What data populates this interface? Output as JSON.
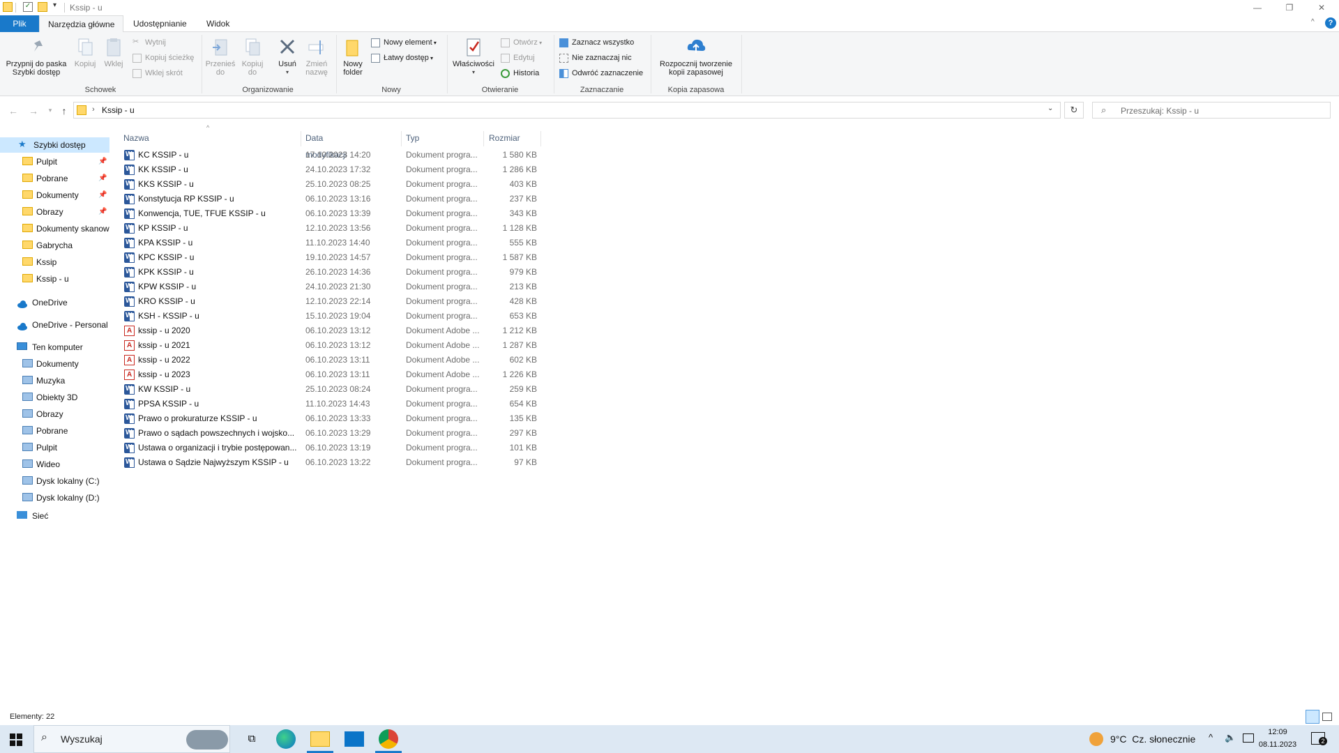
{
  "window": {
    "title": "Kssip - u",
    "minimize": "—",
    "maximize": "❐",
    "close": "✕"
  },
  "tabs": [
    "Plik",
    "Narzędzia główne",
    "Udostępnianie",
    "Widok"
  ],
  "ribbon": {
    "schowek": {
      "label": "Schowek",
      "pin": "Przypnij do paska\nSzybki dostęp",
      "copy": "Kopiuj",
      "paste": "Wklej",
      "cut": "Wytnij",
      "copy_path": "Kopiuj ścieżkę",
      "paste_shortcut": "Wklej skrót"
    },
    "organizuj": {
      "label": "Organizowanie",
      "move": "Przenieś\ndo",
      "copyto": "Kopiuj\ndo",
      "delete": "Usuń",
      "rename": "Zmień\nnazwę"
    },
    "nowy": {
      "label": "Nowy",
      "new_folder": "Nowy\nfolder",
      "new_item": "Nowy element",
      "easy_access": "Łatwy dostęp"
    },
    "otwieranie": {
      "label": "Otwieranie",
      "properties": "Właściwości",
      "open": "Otwórz",
      "edit": "Edytuj",
      "history": "Historia"
    },
    "zaznaczanie": {
      "label": "Zaznaczanie",
      "select_all": "Zaznacz wszystko",
      "select_none": "Nie zaznaczaj nic",
      "invert": "Odwróć zaznaczenie"
    },
    "kopia": {
      "label": "Kopia zapasowa",
      "backup": "Rozpocznij tworzenie\nkopii zapasowej"
    }
  },
  "address": {
    "path": "Kssip - u",
    "search_placeholder": "Przeszukaj: Kssip - u"
  },
  "nav": {
    "quick_access": "Szybki dostęp",
    "quick_items": [
      {
        "label": "Pulpit",
        "pinned": true
      },
      {
        "label": "Pobrane",
        "pinned": true
      },
      {
        "label": "Dokumenty",
        "pinned": true
      },
      {
        "label": "Obrazy",
        "pinned": true
      },
      {
        "label": "Dokumenty skanow",
        "pinned": false
      },
      {
        "label": "Gabrycha",
        "pinned": false
      },
      {
        "label": "Kssip",
        "pinned": false
      },
      {
        "label": "Kssip - u",
        "pinned": false
      }
    ],
    "onedrive": "OneDrive",
    "onedrive_personal": "OneDrive - Personal",
    "this_pc": "Ten komputer",
    "pc_items": [
      "Dokumenty",
      "Muzyka",
      "Obiekty 3D",
      "Obrazy",
      "Pobrane",
      "Pulpit",
      "Wideo",
      "Dysk lokalny (C:)",
      "Dysk lokalny (D:)"
    ],
    "network": "Sieć",
    "pin_glyph": "📌"
  },
  "columns": {
    "name": "Nazwa",
    "date": "Data modyfikacji",
    "type": "Typ",
    "size": "Rozmiar"
  },
  "files": [
    {
      "name": "KC KSSIP - u",
      "date": "17.10.2023 14:20",
      "type": "Dokument progra...",
      "size": "1 580 KB",
      "kind": "word"
    },
    {
      "name": "KK KSSIP - u",
      "date": "24.10.2023 17:32",
      "type": "Dokument progra...",
      "size": "1 286 KB",
      "kind": "word"
    },
    {
      "name": "KKS KSSIP - u",
      "date": "25.10.2023 08:25",
      "type": "Dokument progra...",
      "size": "403 KB",
      "kind": "word"
    },
    {
      "name": "Konstytucja RP KSSIP - u",
      "date": "06.10.2023 13:16",
      "type": "Dokument progra...",
      "size": "237 KB",
      "kind": "word"
    },
    {
      "name": "Konwencja, TUE, TFUE KSSIP - u",
      "date": "06.10.2023 13:39",
      "type": "Dokument progra...",
      "size": "343 KB",
      "kind": "word"
    },
    {
      "name": "KP KSSIP - u",
      "date": "12.10.2023 13:56",
      "type": "Dokument progra...",
      "size": "1 128 KB",
      "kind": "word"
    },
    {
      "name": "KPA KSSIP - u",
      "date": "11.10.2023 14:40",
      "type": "Dokument progra...",
      "size": "555 KB",
      "kind": "word"
    },
    {
      "name": "KPC KSSIP - u",
      "date": "19.10.2023 14:57",
      "type": "Dokument progra...",
      "size": "1 587 KB",
      "kind": "word"
    },
    {
      "name": "KPK KSSIP - u",
      "date": "26.10.2023 14:36",
      "type": "Dokument progra...",
      "size": "979 KB",
      "kind": "word"
    },
    {
      "name": "KPW KSSIP - u",
      "date": "24.10.2023 21:30",
      "type": "Dokument progra...",
      "size": "213 KB",
      "kind": "word"
    },
    {
      "name": "KRO KSSIP - u",
      "date": "12.10.2023 22:14",
      "type": "Dokument progra...",
      "size": "428 KB",
      "kind": "word"
    },
    {
      "name": "KSH - KSSIP - u",
      "date": "15.10.2023 19:04",
      "type": "Dokument progra...",
      "size": "653 KB",
      "kind": "word"
    },
    {
      "name": "kssip - u 2020",
      "date": "06.10.2023 13:12",
      "type": "Dokument Adobe ...",
      "size": "1 212 KB",
      "kind": "pdf"
    },
    {
      "name": "kssip - u 2021",
      "date": "06.10.2023 13:12",
      "type": "Dokument Adobe ...",
      "size": "1 287 KB",
      "kind": "pdf"
    },
    {
      "name": "kssip - u 2022",
      "date": "06.10.2023 13:11",
      "type": "Dokument Adobe ...",
      "size": "602 KB",
      "kind": "pdf"
    },
    {
      "name": "kssip - u 2023",
      "date": "06.10.2023 13:11",
      "type": "Dokument Adobe ...",
      "size": "1 226 KB",
      "kind": "pdf"
    },
    {
      "name": "KW KSSIP - u",
      "date": "25.10.2023 08:24",
      "type": "Dokument progra...",
      "size": "259 KB",
      "kind": "word"
    },
    {
      "name": "PPSA KSSIP - u",
      "date": "11.10.2023 14:43",
      "type": "Dokument progra...",
      "size": "654 KB",
      "kind": "word"
    },
    {
      "name": "Prawo o prokuraturze KSSIP - u",
      "date": "06.10.2023 13:33",
      "type": "Dokument progra...",
      "size": "135 KB",
      "kind": "word"
    },
    {
      "name": "Prawo o sądach powszechnych i wojsko...",
      "date": "06.10.2023 13:29",
      "type": "Dokument progra...",
      "size": "297 KB",
      "kind": "word"
    },
    {
      "name": "Ustawa o organizacji i trybie postępowan...",
      "date": "06.10.2023 13:19",
      "type": "Dokument progra...",
      "size": "101 KB",
      "kind": "word"
    },
    {
      "name": "Ustawa o Sądzie Najwyższym KSSIP - u",
      "date": "06.10.2023 13:22",
      "type": "Dokument progra...",
      "size": "97 KB",
      "kind": "word"
    }
  ],
  "status": {
    "items": "Elementy: 22"
  },
  "taskbar": {
    "search": "Wyszukaj",
    "weather": "9°C  Cz. słonecznie",
    "time": "12:09",
    "date": "08.11.2023",
    "notifications": "2"
  },
  "colors": {
    "accent": "#1979ca",
    "folder": "#ffd86b",
    "word": "#2b579a",
    "pdf": "#c8281f",
    "taskbar": "#dde8f3"
  }
}
